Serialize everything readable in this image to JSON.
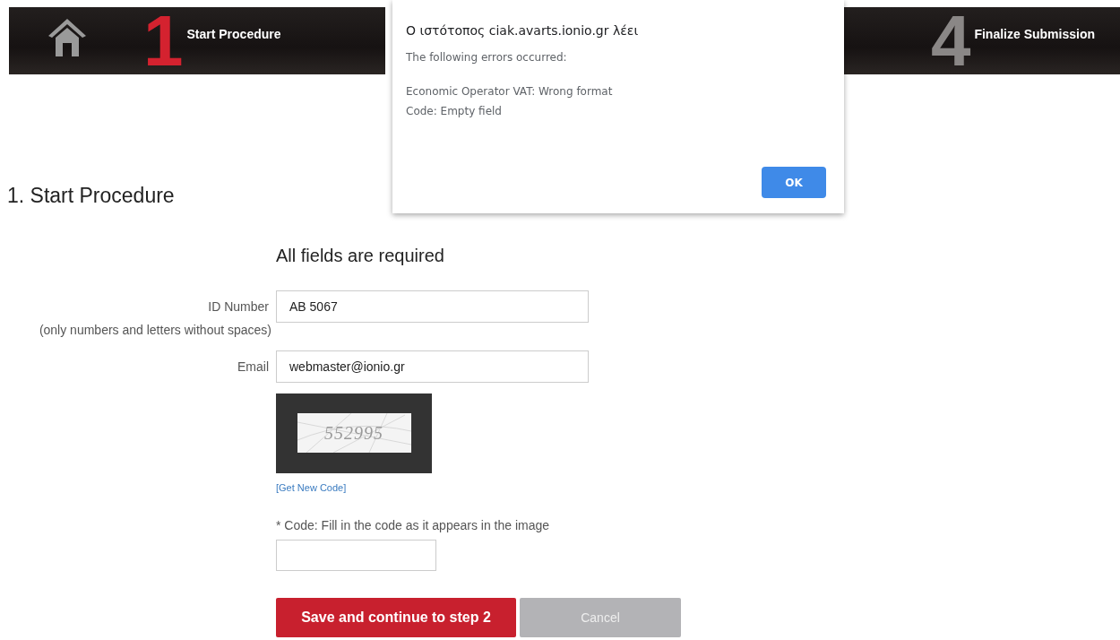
{
  "banners": [
    {
      "number": "1",
      "label": "Start Procedure",
      "home": true
    },
    {
      "number": "4",
      "label": "Finalize Submission",
      "home": false
    }
  ],
  "dialog": {
    "title": "Ο ιστότοπος ciak.avarts.ionio.gr λέει",
    "intro": "The following errors occurred:",
    "errors": [
      "Economic Operator VAT: Wrong format",
      "Code: Empty field"
    ],
    "button": "OK"
  },
  "heading": "1. Start Procedure",
  "form": {
    "note": "All fields are required",
    "fields": [
      {
        "label": "ID Number",
        "value": "AB 5067",
        "hint": "(only numbers and letters without spaces)"
      },
      {
        "label": "Email",
        "value": "webmaster@ionio.gr"
      }
    ],
    "captcha": {
      "code": "552995",
      "link": "[Get New Code]",
      "label": "* Code: Fill in the code as it appears in the image"
    },
    "buttons": [
      {
        "label": "Save and continue to step 2",
        "kind": "primary"
      },
      {
        "label": "Cancel",
        "kind": "secondary"
      }
    ]
  }
}
